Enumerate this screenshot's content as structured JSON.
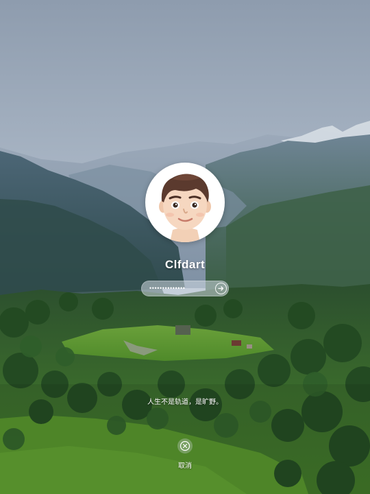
{
  "user": {
    "name": "Clfdart",
    "avatar_icon": "memoji-avatar-icon"
  },
  "password": {
    "masked_value": "••••••••••••••",
    "submit_icon": "arrow-right-circle-icon"
  },
  "lock_message": "人生不是轨道，是旷野。",
  "cancel": {
    "label": "取消",
    "icon": "close-circle-icon"
  },
  "colors": {
    "text": "#ffffff",
    "avatar_background": "#ffffff",
    "field_background": "#d2dae4"
  }
}
